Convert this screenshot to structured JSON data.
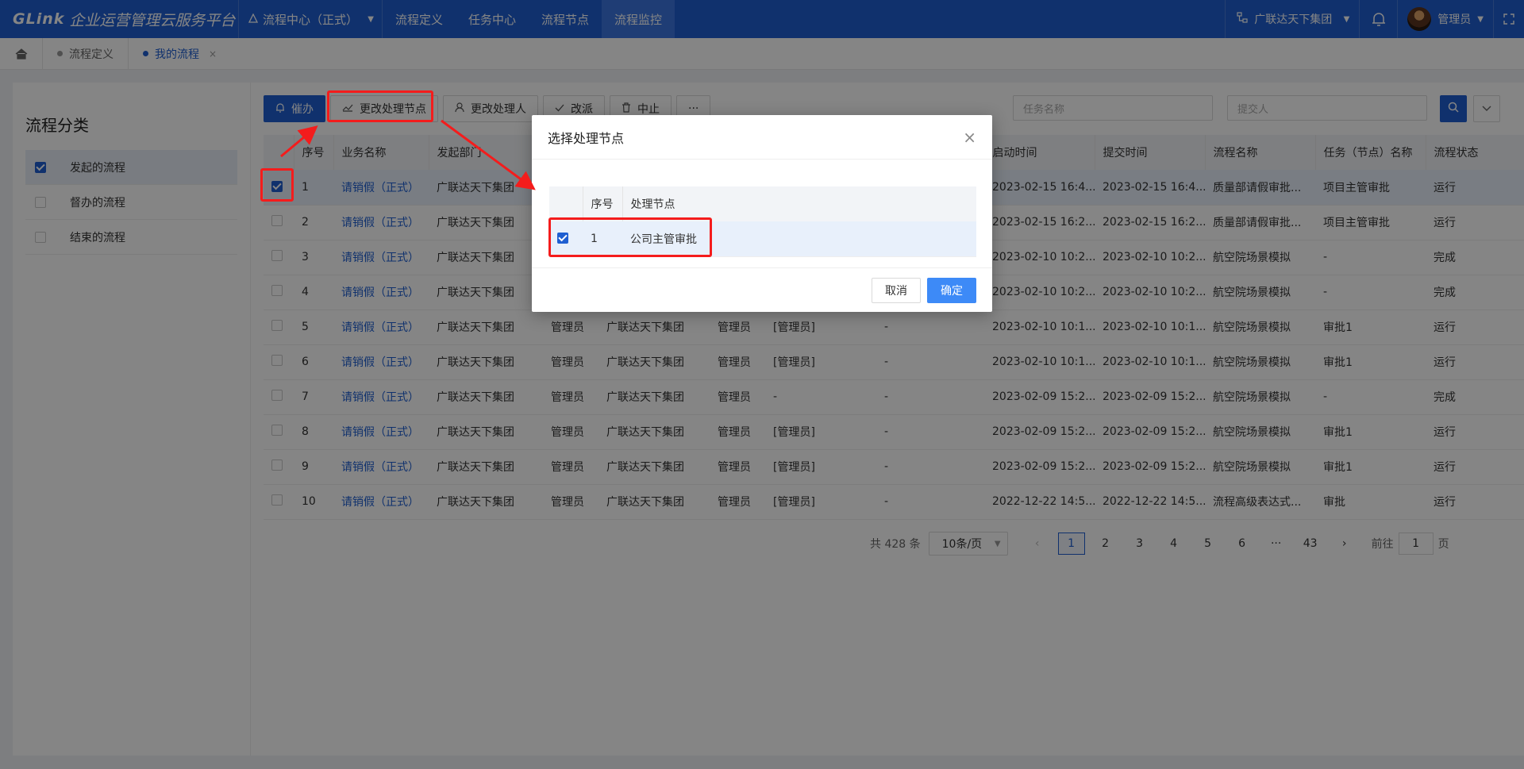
{
  "app": {
    "logo_brand": "GLink",
    "logo_title": "企业运营管理云服务平台",
    "module_select": "流程中心（正式）",
    "nav": [
      "流程定义",
      "任务中心",
      "流程节点",
      "流程监控"
    ],
    "active_nav_index": 3,
    "org": "广联达天下集团",
    "user": "管理员"
  },
  "tabs": [
    {
      "label": "流程定义",
      "active": false
    },
    {
      "label": "我的流程",
      "active": true,
      "close": "×"
    }
  ],
  "sidebar": {
    "title": "流程分类",
    "items": [
      {
        "label": "发起的流程",
        "checked": true
      },
      {
        "label": "督办的流程",
        "checked": false
      },
      {
        "label": "结束的流程",
        "checked": false
      }
    ]
  },
  "toolbar": {
    "urge": "催办",
    "change_node": "更改处理节点",
    "change_handler": "更改处理人",
    "reassign": "改派",
    "terminate": "中止",
    "more": "···",
    "task_name_placeholder": "任务名称",
    "submitter_placeholder": "提交人"
  },
  "table": {
    "headers": [
      "",
      "序号",
      "业务名称",
      "发起部门",
      "",
      "",
      "",
      "",
      "",
      "启动时间",
      "提交时间",
      "流程名称",
      "任务（节点）名称",
      "流程状态"
    ],
    "rows": [
      [
        "1",
        "请销假（正式）",
        "广联达天下集团",
        "",
        "",
        "",
        "",
        "",
        "2023-02-15 16:4...",
        "2023-02-15 16:4...",
        "质量部请假审批...",
        "项目主管审批",
        "运行"
      ],
      [
        "2",
        "请销假（正式）",
        "广联达天下集团",
        "",
        "",
        "",
        "",
        "",
        "2023-02-15 16:2...",
        "2023-02-15 16:2...",
        "质量部请假审批...",
        "项目主管审批",
        "运行"
      ],
      [
        "3",
        "请销假（正式）",
        "广联达天下集团",
        "",
        "",
        "",
        "",
        "",
        "2023-02-10 10:2...",
        "2023-02-10 10:2...",
        "航空院场景模拟",
        "-",
        "完成"
      ],
      [
        "4",
        "请销假（正式）",
        "广联达天下集团",
        "",
        "",
        "",
        "",
        "",
        "2023-02-10 10:2...",
        "2023-02-10 10:2...",
        "航空院场景模拟",
        "-",
        "完成"
      ],
      [
        "5",
        "请销假（正式）",
        "广联达天下集团",
        "管理员",
        "广联达天下集团",
        "管理员",
        "[管理员]",
        "-",
        "2023-02-10 10:1...",
        "2023-02-10 10:1...",
        "航空院场景模拟",
        "审批1",
        "运行"
      ],
      [
        "6",
        "请销假（正式）",
        "广联达天下集团",
        "管理员",
        "广联达天下集团",
        "管理员",
        "[管理员]",
        "-",
        "2023-02-10 10:1...",
        "2023-02-10 10:1...",
        "航空院场景模拟",
        "审批1",
        "运行"
      ],
      [
        "7",
        "请销假（正式）",
        "广联达天下集团",
        "管理员",
        "广联达天下集团",
        "管理员",
        "-",
        "-",
        "2023-02-09 15:2...",
        "2023-02-09 15:2...",
        "航空院场景模拟",
        "-",
        "完成"
      ],
      [
        "8",
        "请销假（正式）",
        "广联达天下集团",
        "管理员",
        "广联达天下集团",
        "管理员",
        "[管理员]",
        "-",
        "2023-02-09 15:2...",
        "2023-02-09 15:2...",
        "航空院场景模拟",
        "审批1",
        "运行"
      ],
      [
        "9",
        "请销假（正式）",
        "广联达天下集团",
        "管理员",
        "广联达天下集团",
        "管理员",
        "[管理员]",
        "-",
        "2023-02-09 15:2...",
        "2023-02-09 15:2...",
        "航空院场景模拟",
        "审批1",
        "运行"
      ],
      [
        "10",
        "请销假（正式）",
        "广联达天下集团",
        "管理员",
        "广联达天下集团",
        "管理员",
        "[管理员]",
        "-",
        "2022-12-22 14:5...",
        "2022-12-22 14:5...",
        "流程高级表达式...",
        "审批",
        "运行"
      ]
    ],
    "selected_row": 0
  },
  "pager": {
    "total": "共 428 条",
    "page_size": "10条/页",
    "pages": [
      "1",
      "2",
      "3",
      "4",
      "5",
      "6",
      "···",
      "43"
    ],
    "current": "1",
    "goto_label": "前往",
    "goto_value": "1",
    "page_suffix": "页"
  },
  "dialog": {
    "title": "选择处理节点",
    "close": "×",
    "headers": [
      "",
      "序号",
      "处理节点"
    ],
    "rows": [
      [
        "1",
        "公司主管审批"
      ]
    ],
    "cancel": "取消",
    "ok": "确定"
  },
  "colors": {
    "brand": "#1f5fd1",
    "annotation": "#f41c1c",
    "primary_button": "#3d8af7"
  }
}
